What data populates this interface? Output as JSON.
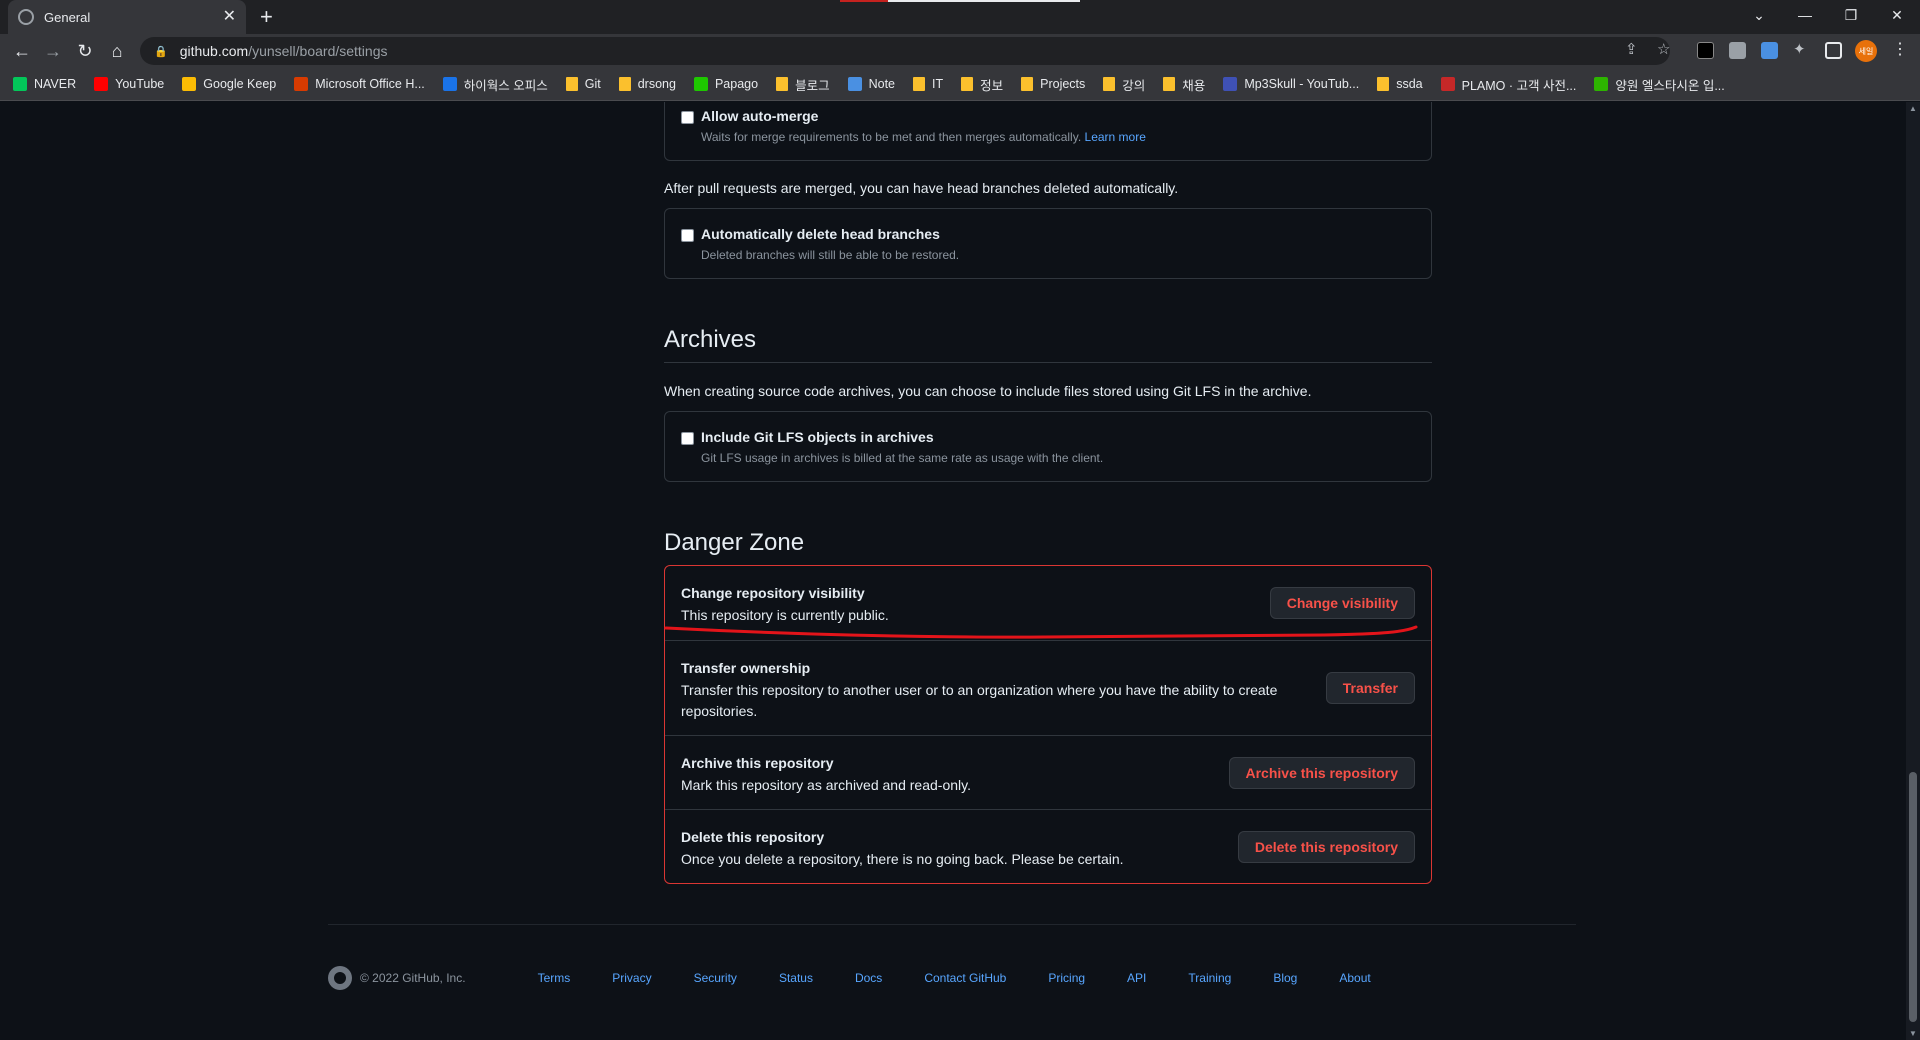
{
  "browser": {
    "tab_title": "General",
    "url_host": "github.com",
    "url_path": "/yunsell/board/settings",
    "bookmarks": [
      {
        "label": "NAVER",
        "color": "#03c75a"
      },
      {
        "label": "YouTube",
        "color": "#ff0000"
      },
      {
        "label": "Google Keep",
        "color": "#fbbc04"
      },
      {
        "label": "Microsoft Office H...",
        "color": "#d83b01"
      },
      {
        "label": "하이웍스 오피스",
        "color": "#1a73e8"
      },
      {
        "label": "Git",
        "color": "folder"
      },
      {
        "label": "drsong",
        "color": "folder"
      },
      {
        "label": "Papago",
        "color": "#1ec800"
      },
      {
        "label": "블로그",
        "color": "folder"
      },
      {
        "label": "Note",
        "color": "#4a90e2"
      },
      {
        "label": "IT",
        "color": "folder"
      },
      {
        "label": "정보",
        "color": "folder"
      },
      {
        "label": "Projects",
        "color": "folder"
      },
      {
        "label": "강의",
        "color": "folder"
      },
      {
        "label": "채용",
        "color": "folder"
      },
      {
        "label": "Mp3Skull - YouTub...",
        "color": "#3f51b5"
      },
      {
        "label": "ssda",
        "color": "folder"
      },
      {
        "label": "PLAMO · 고객 사전...",
        "color": "#c62828"
      },
      {
        "label": "양원 엘스타시온 입...",
        "color": "#2db400"
      }
    ],
    "avatar_text": "세일"
  },
  "merge": {
    "auto_merge_label": "Allow auto-merge",
    "auto_merge_desc": "Waits for merge requirements to be met and then merges automatically.",
    "learn_more": "Learn more",
    "after_merge_text": "After pull requests are merged, you can have head branches deleted automatically.",
    "delete_branches_label": "Automatically delete head branches",
    "delete_branches_desc": "Deleted branches will still be able to be restored."
  },
  "archives": {
    "heading": "Archives",
    "text": "When creating source code archives, you can choose to include files stored using Git LFS in the archive.",
    "lfs_label": "Include Git LFS objects in archives",
    "lfs_desc": "Git LFS usage in archives is billed at the same rate as usage with the client."
  },
  "danger": {
    "heading": "Danger Zone",
    "items": [
      {
        "title": "Change repository visibility",
        "desc": "This repository is currently public.",
        "button": "Change visibility"
      },
      {
        "title": "Transfer ownership",
        "desc": "Transfer this repository to another user or to an organization where you have the ability to create repositories.",
        "button": "Transfer"
      },
      {
        "title": "Archive this repository",
        "desc": "Mark this repository as archived and read-only.",
        "button": "Archive this repository"
      },
      {
        "title": "Delete this repository",
        "desc": "Once you delete a repository, there is no going back. Please be certain.",
        "button": "Delete this repository"
      }
    ]
  },
  "footer": {
    "copyright": "© 2022 GitHub, Inc.",
    "links": [
      "Terms",
      "Privacy",
      "Security",
      "Status",
      "Docs",
      "Contact GitHub",
      "Pricing",
      "API",
      "Training",
      "Blog",
      "About"
    ]
  },
  "colors": {
    "danger_border": "#da3633",
    "danger_text": "#f85149",
    "link": "#58a6ff",
    "annotation": "#e3141a"
  }
}
